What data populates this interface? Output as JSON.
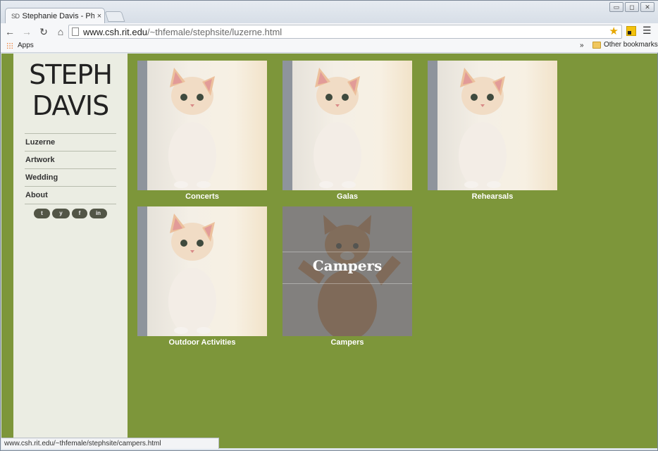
{
  "browser": {
    "tab": {
      "favicon": "SD",
      "title": "Stephanie Davis - Photogr",
      "close_glyph": "×"
    },
    "window_controls": {
      "minimize": "▭",
      "maximize": "◻",
      "close": "✕"
    },
    "address": {
      "host": "www.csh.rit.edu",
      "path": "/~thfemale/stephsite/luzerne.html"
    },
    "bookmarks": {
      "apps_label": "Apps",
      "overflow_label": "»",
      "other_label": "Other bookmarks"
    },
    "status_url": "www.csh.rit.edu/~thfemale/stephsite/campers.html"
  },
  "site": {
    "logo_line1": "STEPH",
    "logo_line2": "DAVIS",
    "nav": [
      "Luzerne",
      "Artwork",
      "Wedding",
      "About"
    ],
    "social": [
      "t",
      "y",
      "f",
      "in"
    ],
    "gallery": [
      {
        "caption": "Concerts"
      },
      {
        "caption": "Galas"
      },
      {
        "caption": "Rehearsals"
      },
      {
        "caption": "Outdoor Activities"
      },
      {
        "caption": "Campers",
        "hover_label": "Campers"
      }
    ]
  },
  "colors": {
    "page_background": "#7d963a",
    "sidebar_background": "#ebede3",
    "overlay": "#5f5f5f"
  }
}
